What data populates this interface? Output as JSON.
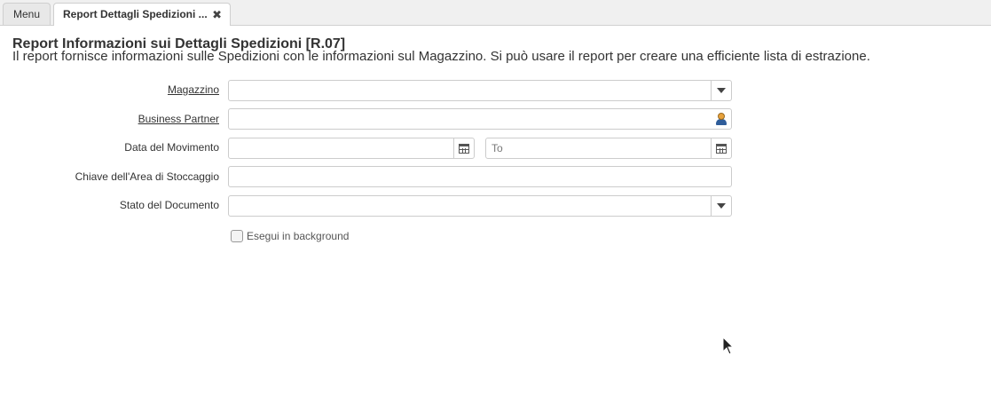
{
  "tabs": {
    "menu_label": "Menu",
    "report_label": "Report Dettagli Spedizioni ...",
    "close_glyph": "✖"
  },
  "header": {
    "title": "Report Informazioni sui Dettagli Spedizioni [R.07]",
    "description": "Il report fornisce informazioni sulle Spedizioni con le informazioni sul Magazzino. Si può usare il report per creare una efficiente lista di estrazione."
  },
  "form": {
    "warehouse": {
      "label": "Magazzino",
      "value": ""
    },
    "business_partner": {
      "label": "Business Partner",
      "value": ""
    },
    "movement_date": {
      "label": "Data del Movimento",
      "from_value": "",
      "to_placeholder": "To"
    },
    "locator_key": {
      "label": "Chiave dell'Area di Stoccaggio",
      "value": ""
    },
    "document_status": {
      "label": "Stato del Documento",
      "value": ""
    },
    "background": {
      "label": "Esegui in background",
      "checked": false
    }
  },
  "icons": {
    "dropdown": "chevron-down-icon",
    "calendar": "calendar-icon",
    "business_partner": "business-partner-icon"
  }
}
